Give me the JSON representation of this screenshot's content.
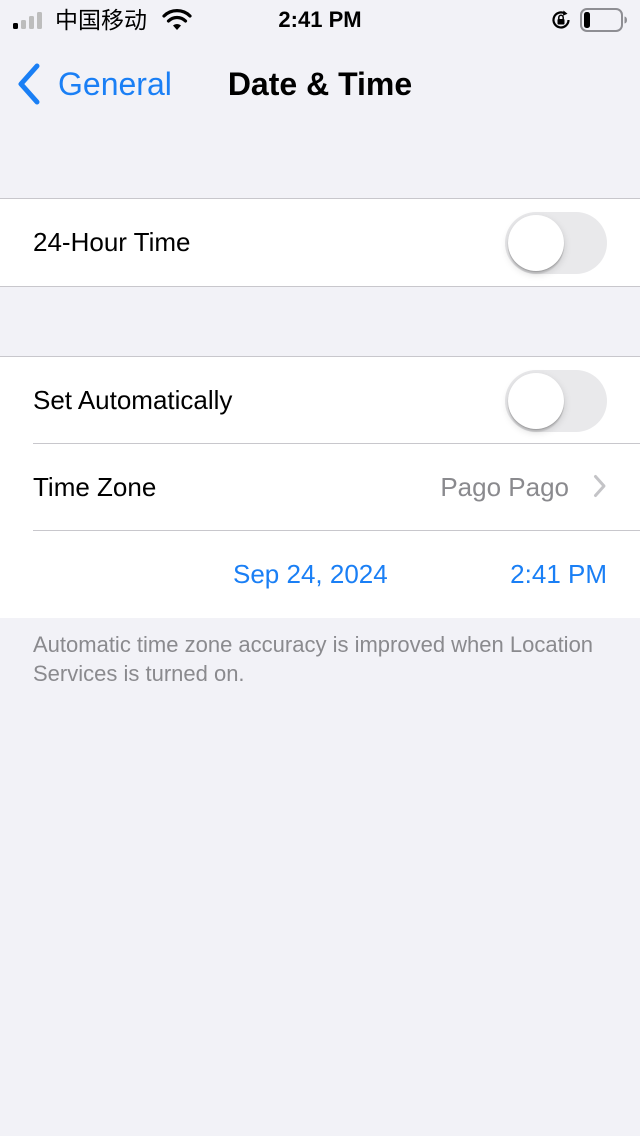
{
  "status_bar": {
    "carrier": "中国移动",
    "time": "2:41 PM",
    "icons": [
      "signal-icon",
      "wifi-icon",
      "lock-rotation-icon",
      "battery-icon"
    ],
    "signal_bars_active": 1,
    "battery_level": 0.15
  },
  "nav": {
    "back_label": "General",
    "title": "Date & Time"
  },
  "group1": {
    "hour24_label": "24-Hour Time",
    "hour24_on": false
  },
  "group2": {
    "set_auto_label": "Set Automatically",
    "set_auto_on": false,
    "timezone_label": "Time Zone",
    "timezone_value": "Pago Pago",
    "date_value": "Sep 24, 2024",
    "time_value": "2:41 PM"
  },
  "footer": "Automatic time zone accuracy is improved when Location Services is turned on.",
  "colors": {
    "accent": "#1a7ff5",
    "background": "#f2f2f7",
    "secondary_text": "#8a8a8e",
    "toggle_off": "#e9e9eb"
  }
}
